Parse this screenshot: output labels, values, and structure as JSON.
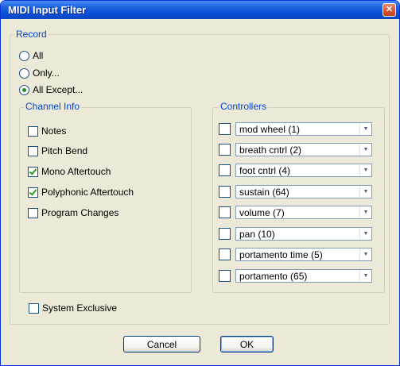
{
  "window": {
    "title": "MIDI Input Filter",
    "close_glyph": "✕"
  },
  "record": {
    "label": "Record",
    "options": [
      {
        "label": "All",
        "selected": false
      },
      {
        "label": "Only...",
        "selected": false
      },
      {
        "label": "All Except...",
        "selected": true
      }
    ]
  },
  "channel_info": {
    "label": "Channel Info",
    "items": [
      {
        "label": "Notes",
        "checked": false
      },
      {
        "label": "Pitch Bend",
        "checked": false
      },
      {
        "label": "Mono Aftertouch",
        "checked": true
      },
      {
        "label": "Polyphonic Aftertouch",
        "checked": true
      },
      {
        "label": "Program Changes",
        "checked": false
      }
    ]
  },
  "controllers": {
    "label": "Controllers",
    "items": [
      {
        "value": "mod wheel (1)",
        "checked": false
      },
      {
        "value": "breath cntrl (2)",
        "checked": false
      },
      {
        "value": "foot cntrl (4)",
        "checked": false
      },
      {
        "value": "sustain (64)",
        "checked": false
      },
      {
        "value": "volume (7)",
        "checked": false
      },
      {
        "value": "pan (10)",
        "checked": false
      },
      {
        "value": "portamento time (5)",
        "checked": false
      },
      {
        "value": "portamento (65)",
        "checked": false
      }
    ]
  },
  "system_exclusive": {
    "label": "System Exclusive",
    "checked": false
  },
  "buttons": {
    "cancel": "Cancel",
    "ok": "OK"
  },
  "icons": {
    "dropdown": "chevron-down-icon",
    "close": "close-icon"
  }
}
